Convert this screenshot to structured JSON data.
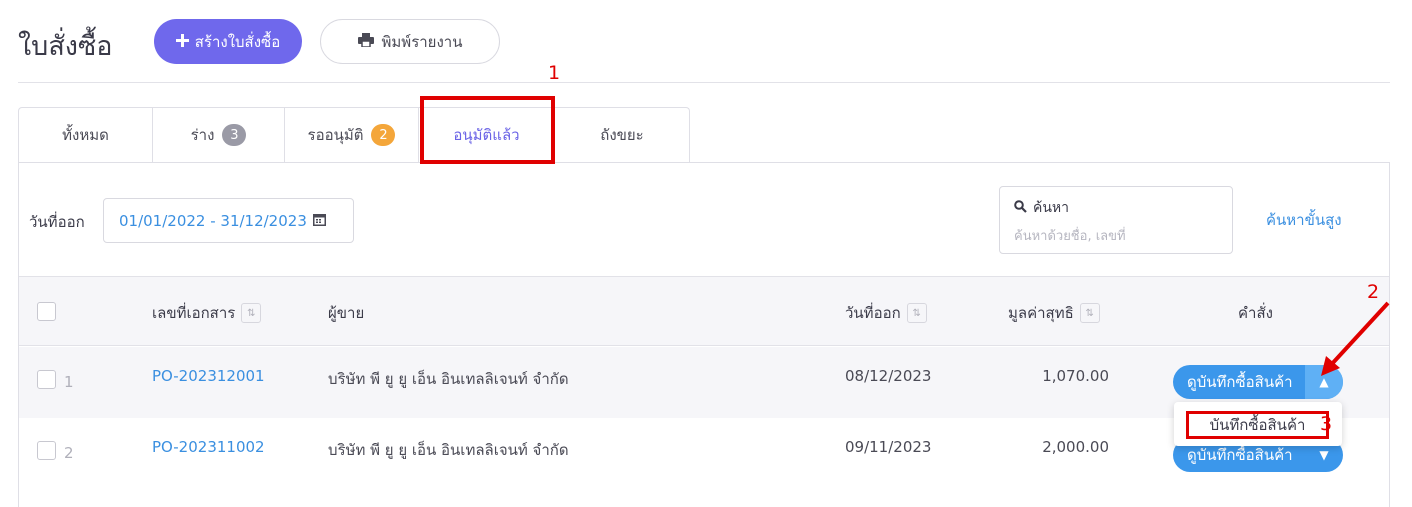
{
  "header": {
    "title": "ใบสั่งซื้อ",
    "create_label": "สร้างใบสั่งซื้อ",
    "print_label": "พิมพ์รายงาน"
  },
  "tabs": [
    {
      "label": "ทั้งหมด",
      "badge": null
    },
    {
      "label": "ร่าง",
      "badge": "3"
    },
    {
      "label": "รออนุมัติ",
      "badge": "2"
    },
    {
      "label": "อนุมัติแล้ว",
      "badge": null,
      "active": true
    },
    {
      "label": "ถังขยะ",
      "badge": null
    }
  ],
  "filters": {
    "date_label": "วันที่ออก",
    "date_range": "01/01/2022 - 31/12/2023",
    "search_label": "ค้นหา",
    "search_placeholder": "ค้นหาด้วยชื่อ, เลขที่",
    "advanced_search": "ค้นหาขั้นสูง"
  },
  "table": {
    "columns": [
      "เลขที่เอกสาร",
      "ผู้ขาย",
      "วันที่ออก",
      "มูลค่าสุทธิ",
      "คำสั่ง"
    ],
    "rows": [
      {
        "num": "1",
        "doc_no": "PO-202312001",
        "vendor": "บริษัท พี ยู ยู เอ็น อินเทลลิเจนท์ จำกัด",
        "date": "08/12/2023",
        "amount": "1,070.00",
        "action": "ดูบันทึกซื้อสินค้า"
      },
      {
        "num": "2",
        "doc_no": "PO-202311002",
        "vendor": "บริษัท พี ยู ยู เอ็น อินเทลลิเจนท์ จำกัด",
        "date": "09/11/2023",
        "amount": "2,000.00",
        "action": "ดูบันทึกซื้อสินค้า"
      }
    ]
  },
  "dropdown": {
    "item": "บันทึกซื้อสินค้า"
  },
  "annotations": [
    "1",
    "2",
    "3"
  ],
  "colors": {
    "primary": "#6f68ec",
    "link": "#3a8fe0",
    "action": "#3b97eb",
    "annotation": "#e00000",
    "badge_gray": "#9a9aa6",
    "badge_orange": "#f4a63a"
  },
  "icons": [
    "plus-icon",
    "printer-icon",
    "calendar-icon",
    "search-icon",
    "sort-icon",
    "chevron-up-icon",
    "chevron-down-icon"
  ]
}
